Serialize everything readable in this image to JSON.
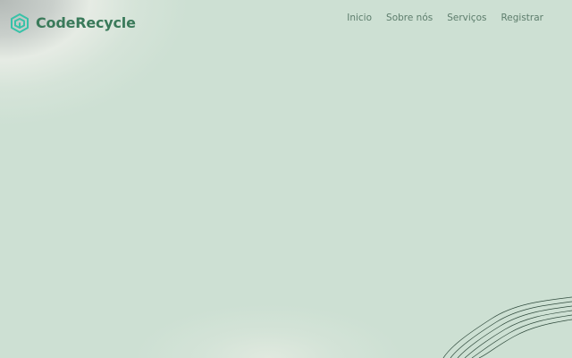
{
  "brand": {
    "name": "CodeRecycle",
    "logo_icon": "recycle-cube-icon",
    "color": "#3a7a5a",
    "logo_color": "#38c2a8"
  },
  "nav": {
    "items": [
      {
        "label": "Inicio"
      },
      {
        "label": "Sobre nós"
      },
      {
        "label": "Serviços"
      },
      {
        "label": "Registrar"
      }
    ],
    "color": "#5d7d6c"
  },
  "background": {
    "color": "#cde0d3",
    "decoration": "wave-lines-icon"
  }
}
